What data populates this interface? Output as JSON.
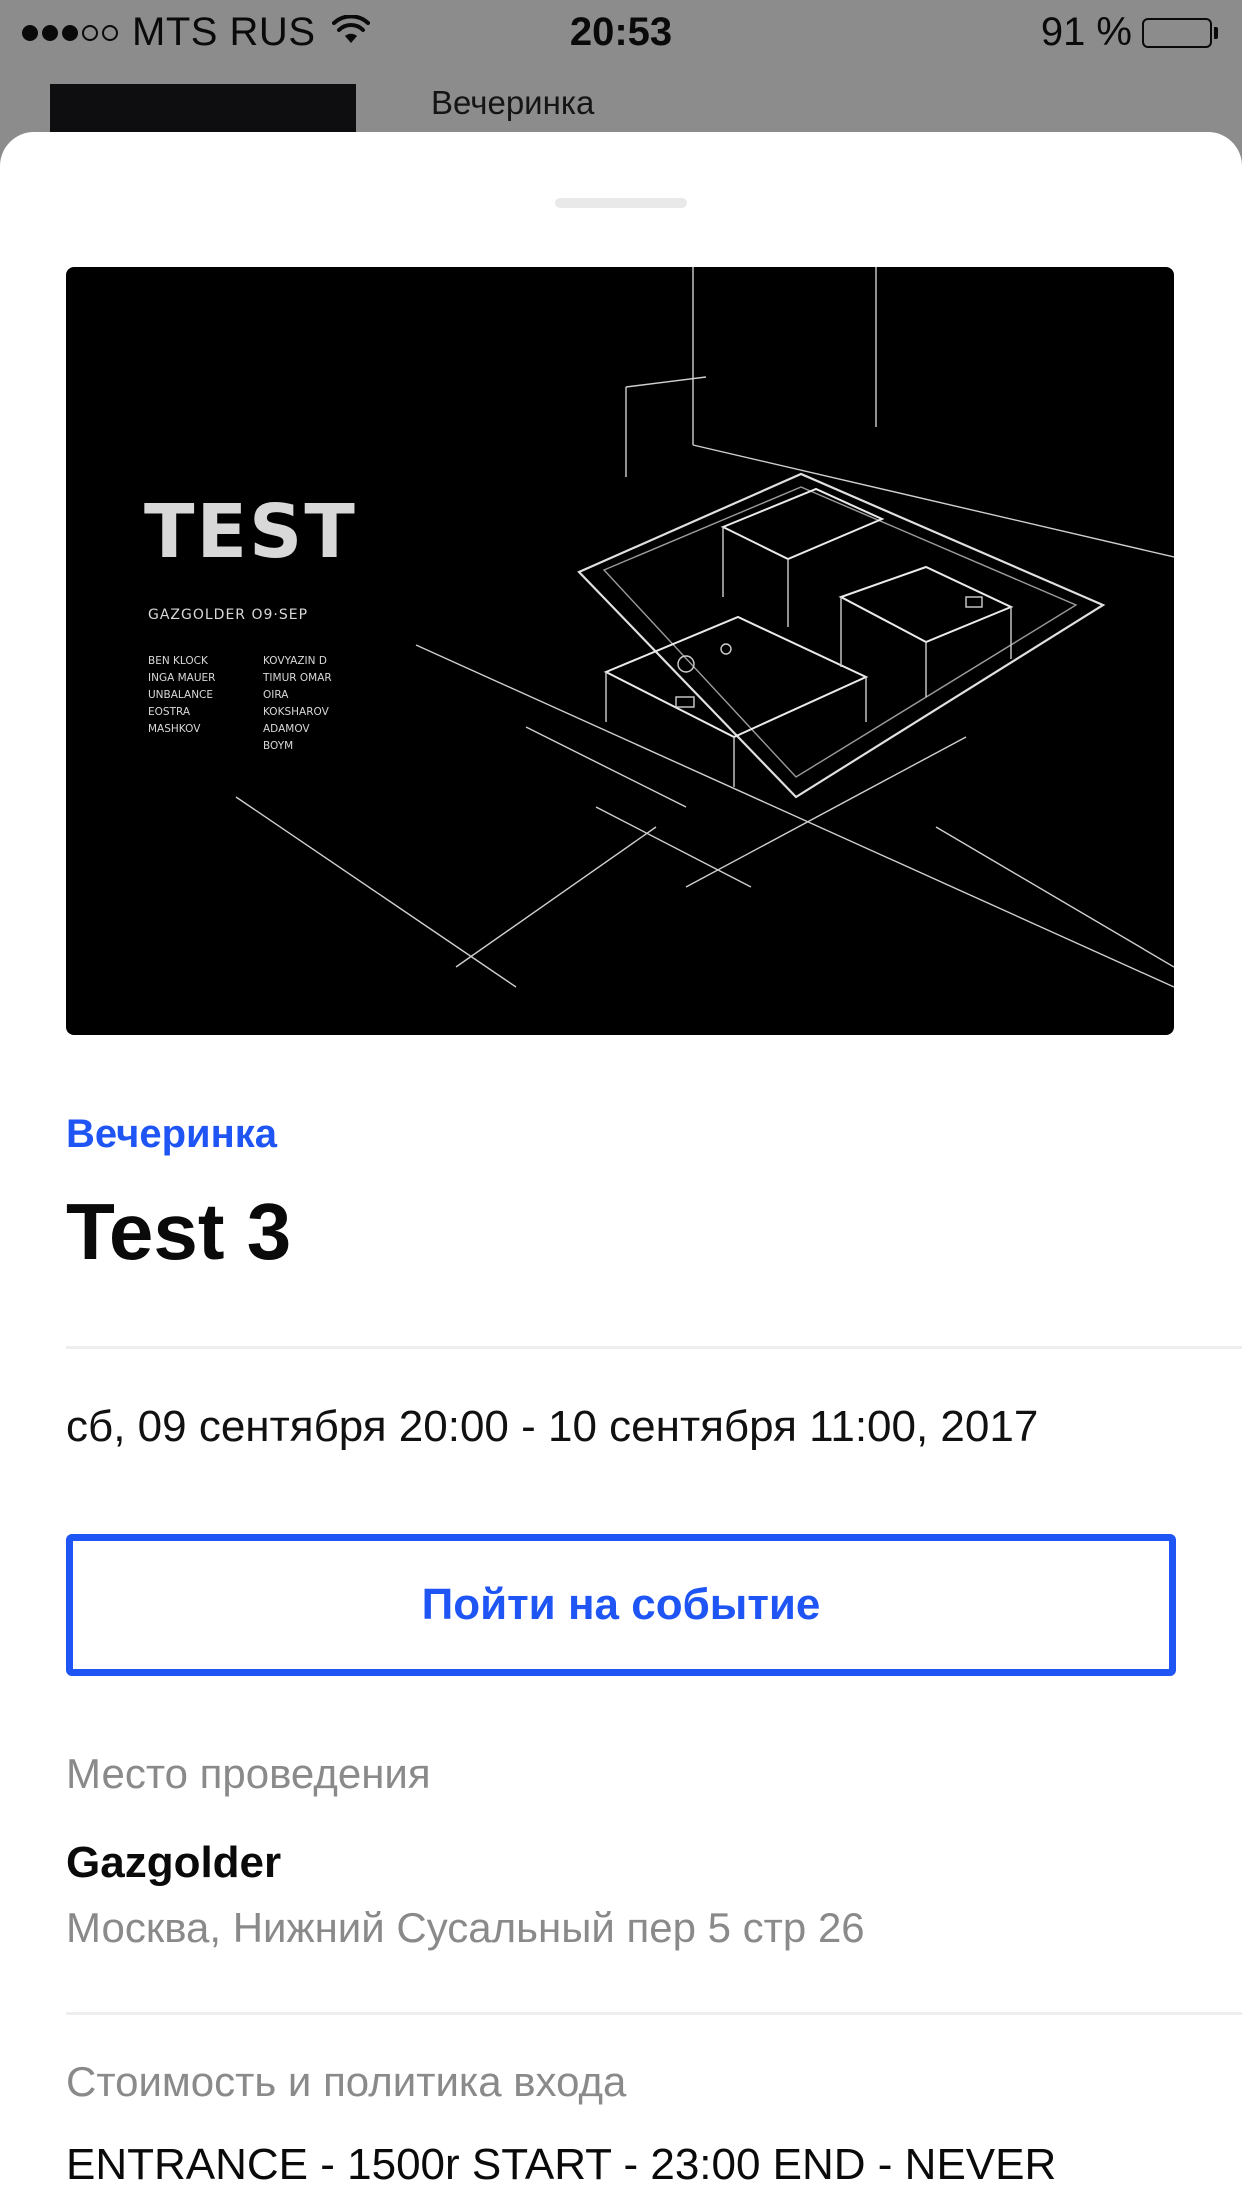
{
  "status_bar": {
    "signal_icon": "signal-dots-icon",
    "signal_strength": 3,
    "signal_max": 5,
    "carrier": "MTS RUS",
    "wifi_icon": "wifi-icon",
    "time": "20:53",
    "battery": "91 %",
    "battery_level": 0.91,
    "battery_icon": "battery-icon"
  },
  "background_list": {
    "item_title": "Вечеринка"
  },
  "event": {
    "poster": {
      "headline": "TEST",
      "venue_date": "GAZGOLDER   O9·SEP",
      "lineup_left": [
        "BEN KLOCK",
        "INGA MAUER",
        "UNBALANCE",
        "EOSTRA",
        "MASHKOV"
      ],
      "lineup_right": [
        "KOVYAZIN D",
        "TIMUR OMAR",
        "OIRA",
        "KOKSHAROV",
        "ADAMOV",
        "BOYM"
      ]
    },
    "category": "Вечеринка",
    "title": "Test 3",
    "date": "сб, 09 сентября 20:00 - 10 сентября 11:00, 2017",
    "attend_button_label": "Пойти на событие",
    "venue_label": "Место проведения",
    "venue_name": "Gazgolder",
    "venue_address": "Москва, Нижний Сусальный пер 5 стр 26",
    "price_label": "Стоимость и политика входа",
    "price_text": "ENTRANCE - 1500r START - 23:00 END - NEVER"
  },
  "colors": {
    "accent": "#1f55f5",
    "overlay": "#8c8c8c",
    "secondary_text": "#8a8a8a"
  }
}
